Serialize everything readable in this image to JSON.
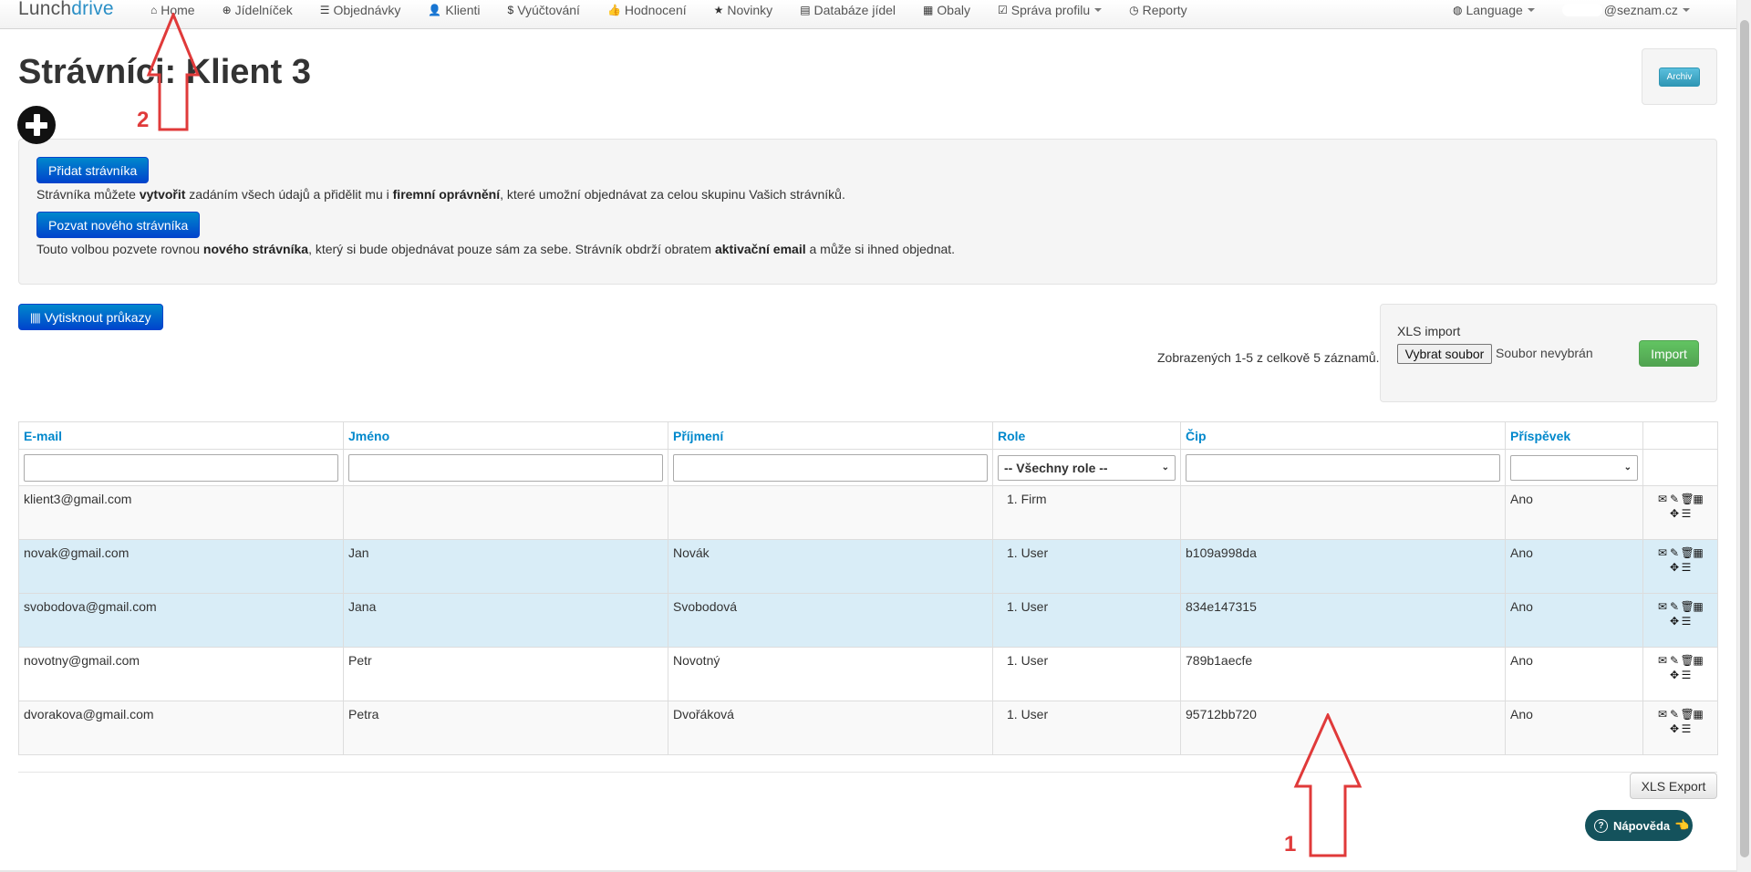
{
  "brand": {
    "part1": "Lunch",
    "part2": "drive"
  },
  "nav": {
    "items": [
      {
        "label": "Home",
        "icon": "home-icon",
        "glyph": "⌂"
      },
      {
        "label": "Jídelníček",
        "icon": "plus-circle-icon",
        "glyph": "⊕"
      },
      {
        "label": "Objednávky",
        "icon": "list-icon",
        "glyph": "☰"
      },
      {
        "label": "Klienti",
        "icon": "user-icon",
        "glyph": "👤"
      },
      {
        "label": "Vyúčtování",
        "icon": "dollar-icon",
        "glyph": "$"
      },
      {
        "label": "Hodnocení",
        "icon": "thumbs-up-icon",
        "glyph": "👍"
      },
      {
        "label": "Novinky",
        "icon": "star-icon",
        "glyph": "★"
      },
      {
        "label": "Databáze jídel",
        "icon": "file-icon",
        "glyph": "▤"
      },
      {
        "label": "Obaly",
        "icon": "grid-icon",
        "glyph": "▦"
      },
      {
        "label": "Správa profilu",
        "icon": "check-square-icon",
        "glyph": "☑"
      },
      {
        "label": "Reporty",
        "icon": "clock-icon",
        "glyph": "◷"
      }
    ],
    "language": "Language",
    "user_email": "@seznam.cz"
  },
  "page": {
    "title": "Strávníci: Klient 3",
    "archiv_label": "Archiv"
  },
  "info": {
    "add_button": "Přidat strávníka",
    "add_text_1": "Strávníka můžete ",
    "add_text_b1": "vytvořit",
    "add_text_2": " zadáním všech údajů a přidělit mu i ",
    "add_text_b2": "firemní oprávnění",
    "add_text_3": ", které umožní objednávat za celou skupinu Vašich strávníků.",
    "invite_button": "Pozvat nového strávníka",
    "invite_text_1": "Touto volbou pozvete rovnou ",
    "invite_text_b1": "nového strávníka",
    "invite_text_2": ", který si bude objednávat pouze sám za sebe. Strávník obdrží obratem ",
    "invite_text_b2": "aktivační email",
    "invite_text_3": " a může si ihned objednat."
  },
  "print_button": "Vytisknout průkazy",
  "records": "Zobrazených 1-5 z celkově 5 záznamů.",
  "import": {
    "label": "XLS import",
    "choose": "Vybrat soubor",
    "status": "Soubor nevybrán",
    "button": "Import"
  },
  "table": {
    "columns": [
      "E-mail",
      "Jméno",
      "Příjmení",
      "Role",
      "Čip",
      "Příspěvek"
    ],
    "role_filter": "-- Všechny role --",
    "rows": [
      {
        "email": "klient3@gmail.com",
        "first": "",
        "last": "",
        "role": "1. Firm",
        "chip": "",
        "contribution": "Ano"
      },
      {
        "email": "novak@gmail.com",
        "first": "Jan",
        "last": "Novák",
        "role": "1. User",
        "chip": "b109a998da",
        "contribution": "Ano"
      },
      {
        "email": "svobodova@gmail.com",
        "first": "Jana",
        "last": "Svobodová",
        "role": "1. User",
        "chip": "834e147315",
        "contribution": "Ano"
      },
      {
        "email": "novotny@gmail.com",
        "first": "Petr",
        "last": "Novotný",
        "role": "1. User",
        "chip": "789b1aecfe",
        "contribution": "Ano"
      },
      {
        "email": "dvorakova@gmail.com",
        "first": "Petra",
        "last": "Dvořáková",
        "role": "1. User",
        "chip": "95712bb720",
        "contribution": "Ano"
      }
    ]
  },
  "xls_export": "XLS Export",
  "help": {
    "label": "Nápověda",
    "hand": "👈"
  },
  "annotations": {
    "arrow1": "1",
    "arrow2": "2",
    "color": "#e03a3a"
  }
}
